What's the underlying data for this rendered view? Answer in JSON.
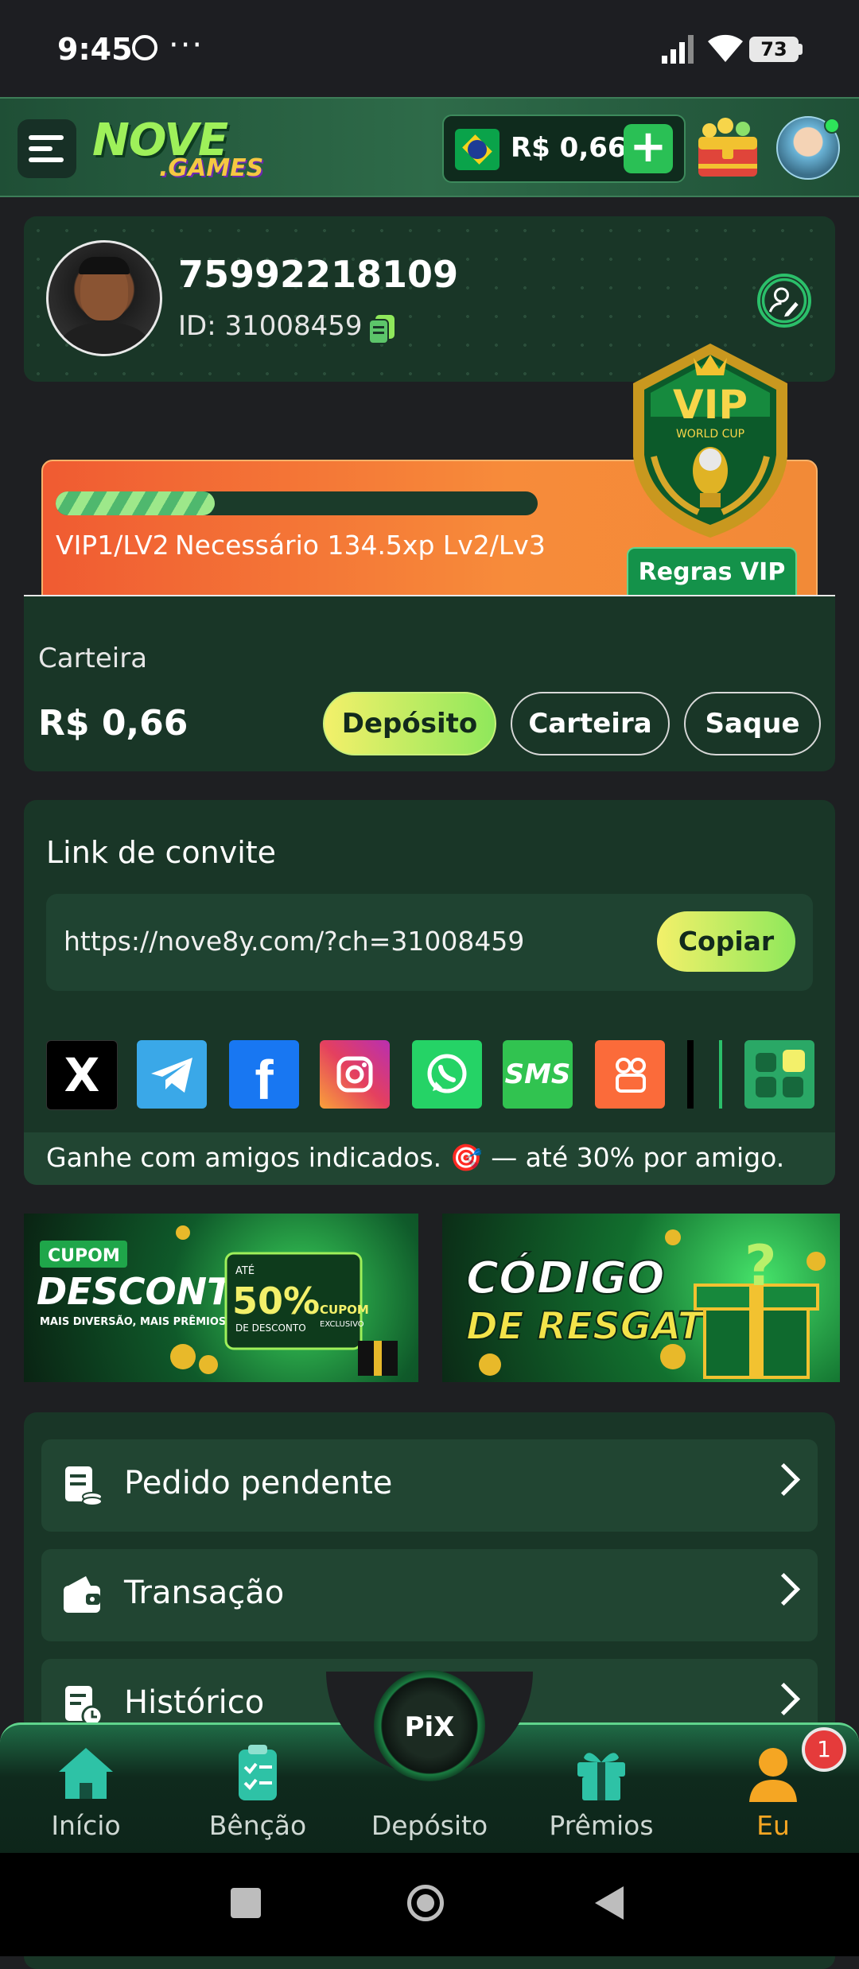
{
  "status_bar": {
    "time": "9:45",
    "dots": "···",
    "battery": "73"
  },
  "header": {
    "logo_top": "NOVE",
    "logo_bottom": ".GAMES",
    "balance": "R$ 0,66",
    "add_symbol": "+"
  },
  "profile": {
    "username": "75992218109",
    "user_id": "ID: 31008459"
  },
  "vip": {
    "progress": 0.33,
    "level": "VIP1/LV2",
    "requirement": "Necessário 134.5xp Lv2/Lv3",
    "rules_label": "Regras VIP",
    "badge_title": "VIP",
    "badge_subtitle": "WORLD CUP"
  },
  "wallet": {
    "label": "Carteira",
    "amount": "R$ 0,66",
    "deposit_label": "Depósito",
    "wallet_label": "Carteira",
    "withdraw_label": "Saque"
  },
  "invite": {
    "title": "Link de convite",
    "url": "https://nove8y.com/?ch=31008459",
    "copy_label": "Copiar",
    "footer": "Ganhe com amigos indicados. 🎯 — até 30% por amigo.",
    "share_sms": "SMS",
    "share_x": "X",
    "share_facebook": "f"
  },
  "banners": {
    "coupon_tag": "CUPOM",
    "coupon_title": "DESCONTO",
    "coupon_sub": "MAIS DIVERSÃO, MAIS PRÊMIOS!",
    "coupon_upto": "ATÉ",
    "coupon_pct": "50%",
    "coupon_pct_sub": "DE DESCONTO",
    "coupon_exclusive": "CUPOM",
    "coupon_exclusive_sub": "EXCLUSIVO",
    "code_title_1": "CÓDIGO",
    "code_title_2": "DE RESGATE"
  },
  "menu": {
    "items": [
      {
        "label": "Pedido pendente"
      },
      {
        "label": "Transação"
      },
      {
        "label": "Histórico"
      }
    ]
  },
  "bottom_nav": {
    "items": [
      {
        "label": "Início"
      },
      {
        "label": "Bênção"
      },
      {
        "label": "Depósito"
      },
      {
        "label": "Prêmios"
      },
      {
        "label": "Eu"
      }
    ],
    "pix": "PiX",
    "badge": "1",
    "active_color": "#f5a623"
  },
  "colors": {
    "accent_green": "#2ac055",
    "card_bg": "#193627",
    "vip_orange": "#f47a36"
  }
}
